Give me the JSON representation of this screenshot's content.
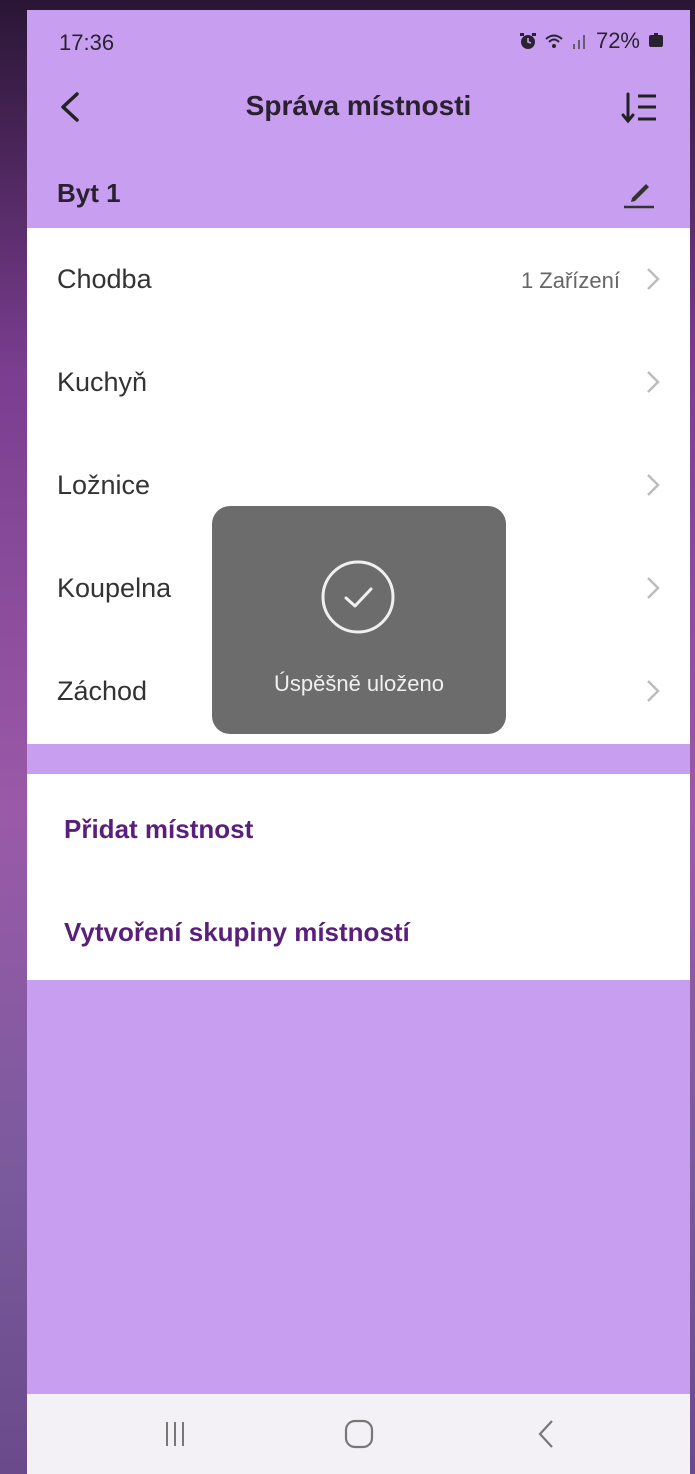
{
  "status": {
    "time": "17:36",
    "battery": "72%",
    "icons": [
      "alarm-icon",
      "wifi-icon",
      "signal-icon",
      "battery-icon"
    ]
  },
  "header": {
    "title": "Správa místnosti",
    "back_icon": "back-arrow-icon",
    "sort_icon": "sort-list-icon"
  },
  "home": {
    "name": "Byt 1",
    "edit_icon": "edit-pencil-icon"
  },
  "rooms": [
    {
      "name": "Chodba",
      "devices": "1 Zařízení"
    },
    {
      "name": "Kuchyň",
      "devices": ""
    },
    {
      "name": "Ložnice",
      "devices": ""
    },
    {
      "name": "Koupelna",
      "devices": ""
    },
    {
      "name": "Záchod",
      "devices": ""
    }
  ],
  "actions": {
    "add_room": "Přidat místnost",
    "create_group": "Vytvoření skupiny místností"
  },
  "toast": {
    "message": "Úspěšně uloženo",
    "icon": "check-circle-icon"
  },
  "nav": {
    "icons": [
      "recent-apps-icon",
      "home-icon",
      "back-icon"
    ]
  },
  "colors": {
    "accent_bg": "#c89ff0",
    "link": "#5a1f7a"
  }
}
